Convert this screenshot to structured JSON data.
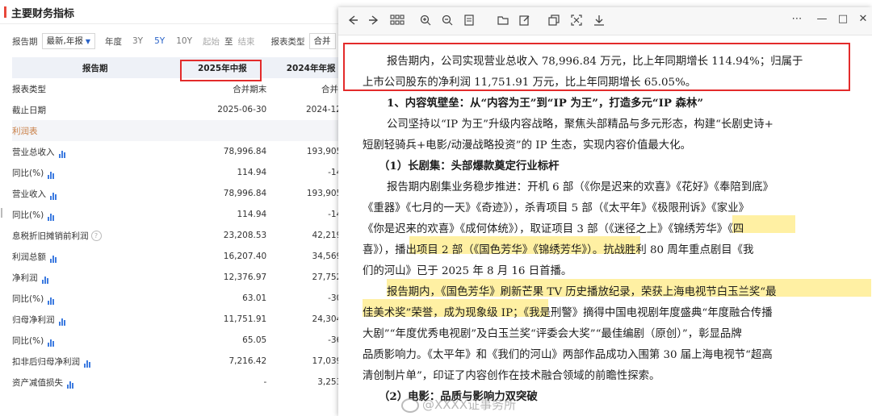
{
  "panel": {
    "title": "主要财务指标",
    "filters": {
      "period_label": "报告期",
      "period_value": "最新,年报",
      "year_label": "年度",
      "years": [
        "3Y",
        "5Y",
        "10Y"
      ],
      "start": "起始",
      "to": "至",
      "end": "结束",
      "type_label": "报表类型",
      "type_value": "合并"
    },
    "header": {
      "col0": "报告期",
      "col1": "2025年中报",
      "col2": "2024年年报"
    },
    "rows": [
      {
        "label": "报表类型",
        "v1": "合并期末",
        "v2": "合并期末",
        "level": 0
      },
      {
        "label": "截止日期",
        "v1": "2025-06-30",
        "v2": "2024-12-31",
        "level": 0
      },
      {
        "label": "利润表",
        "v1": "",
        "v2": "",
        "level": "section"
      },
      {
        "label": "营业总收入",
        "v1": "78,996.84",
        "v2": "193,905.79",
        "level": 1,
        "chart": true
      },
      {
        "label": "同比(%)",
        "v1": "114.94",
        "v2": "-14.48",
        "level": 2,
        "chart": true
      },
      {
        "label": "营业收入",
        "v1": "78,996.84",
        "v2": "193,905.79",
        "level": 1,
        "chart": true
      },
      {
        "label": "同比(%)",
        "v1": "114.94",
        "v2": "-14.48",
        "level": 2,
        "chart": true
      },
      {
        "label": "息税折旧摊销前利润",
        "v1": "23,208.53",
        "v2": "42,219.39",
        "level": 1,
        "help": "?"
      },
      {
        "label": "利润总额",
        "v1": "16,207.40",
        "v2": "34,569.72",
        "level": 1,
        "chart": true
      },
      {
        "label": "净利润",
        "v1": "12,376.97",
        "v2": "27,752.82",
        "level": 1,
        "chart": true
      },
      {
        "label": "同比(%)",
        "v1": "63.01",
        "v2": "-30.08",
        "level": 2,
        "chart": true
      },
      {
        "label": "归母净利润",
        "v1": "11,751.91",
        "v2": "24,304.78",
        "level": 1,
        "chart": true
      },
      {
        "label": "同比(%)",
        "v1": "65.05",
        "v2": "-36.41",
        "level": 2,
        "chart": true
      },
      {
        "label": "扣非后归母净利润",
        "v1": "7,216.42",
        "v2": "17,039.13",
        "level": 1,
        "chart": true
      },
      {
        "label": "资产减值损失",
        "v1": "-",
        "v2": "3,253.58",
        "level": 1,
        "chart": true
      }
    ]
  },
  "viewer": {
    "toolbar_icons": [
      "back-icon",
      "forward-icon",
      "grid-icon",
      "zoom-in-icon",
      "zoom-out-icon",
      "page-icon",
      "folder-icon",
      "edit-icon",
      "copy-icon",
      "crop-icon",
      "download-icon"
    ],
    "window_controls": [
      "⋯",
      "—",
      "□",
      "✕"
    ],
    "lines": [
      "报告期内，公司实现营业总收入 78,996.84 万元，比上年同期增长 114.94%；归属于",
      "上市公司股东的净利润 11,751.91 万元，比上年同期增长 65.05%。",
      "1、内容筑壁垒：从“内容为王”到“IP 为王”，打造多元“IP 森林”",
      "公司坚持以“IP 为王”升级内容战略，聚焦头部精品与多元形态，构建“长剧史诗+",
      "短剧轻骑兵+电影/动漫战略投资”的 IP 生态，实现内容价值最大化。",
      "（1）长剧集：头部爆款奠定行业标杆",
      "报告期内剧集业务稳步推进：开机 6 部（《你是迟来的欢喜》《花好》《奉陪到底》",
      "《重器》《七月的一天》《奇迹》），杀青项目 5 部（《太平年》《极限刑诉》《家业》",
      "《你是迟来的欢喜》《成何体统》），取证项目 3 部（《迷径之上》《锦绣芳华》《四",
      "喜》），播出项目 2 部（《国色芳华》《锦绣芳华》）。抗战胜利 80 周年重点剧目《我",
      "们的河山》已于 2025 年 8 月 16 日首播。",
      "报告期内，《国色芳华》刷新芒果 TV 历史播放纪录，荣获上海电视节白玉兰奖“最",
      "佳美术奖”荣誉，成为现象级 IP；《我是刑警》摘得中国电视剧年度盛典“年度融合传播",
      "大剧”“年度优秀电视剧”及白玉兰奖“评委会大奖”“最佳编剧（原创）”，彰显品牌",
      "品质影响力。《太平年》和《我们的河山》两部作品成功入围第 30 届上海电视节“超高",
      "清创制片单”，印证了内容创作在技术融合领域的前瞻性探索。",
      "（2）电影：品质与影响力双突破"
    ],
    "watermark": "@XXXX证事务所"
  }
}
